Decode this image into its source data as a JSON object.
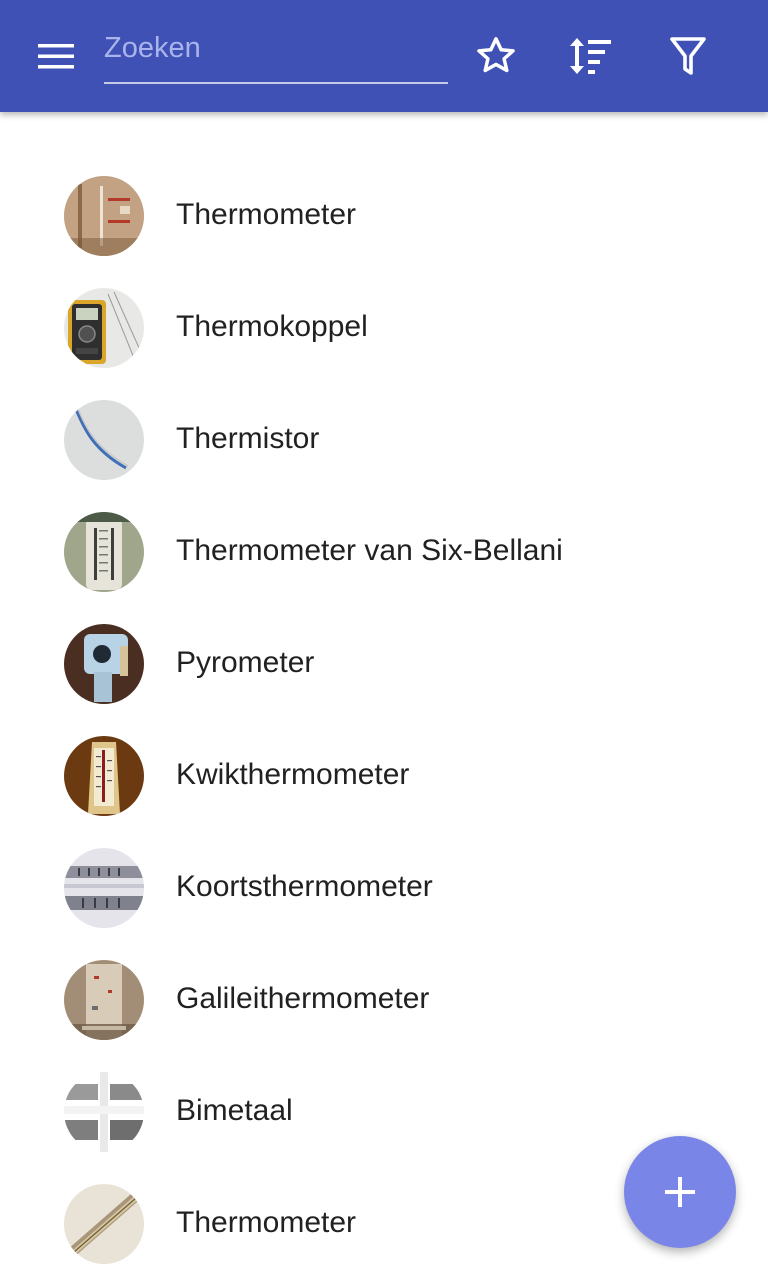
{
  "toolbar": {
    "menu_icon": "menu-icon",
    "search": {
      "placeholder": "Zoeken",
      "value": ""
    },
    "favorite_icon": "star-outline-icon",
    "sort_icon": "sort-icon",
    "filter_icon": "filter-icon"
  },
  "colors": {
    "appbar": "#3f51b5",
    "fab": "#7986e8",
    "text": "#212121"
  },
  "items": [
    {
      "label": "Thermometer"
    },
    {
      "label": "Thermokoppel"
    },
    {
      "label": "Thermistor"
    },
    {
      "label": "Thermometer van Six-Bellani"
    },
    {
      "label": "Pyrometer"
    },
    {
      "label": "Kwikthermometer"
    },
    {
      "label": "Koortsthermometer"
    },
    {
      "label": "Galileithermometer"
    },
    {
      "label": "Bimetaal"
    },
    {
      "label": "Thermometer"
    }
  ],
  "fab": {
    "icon": "plus-icon"
  }
}
